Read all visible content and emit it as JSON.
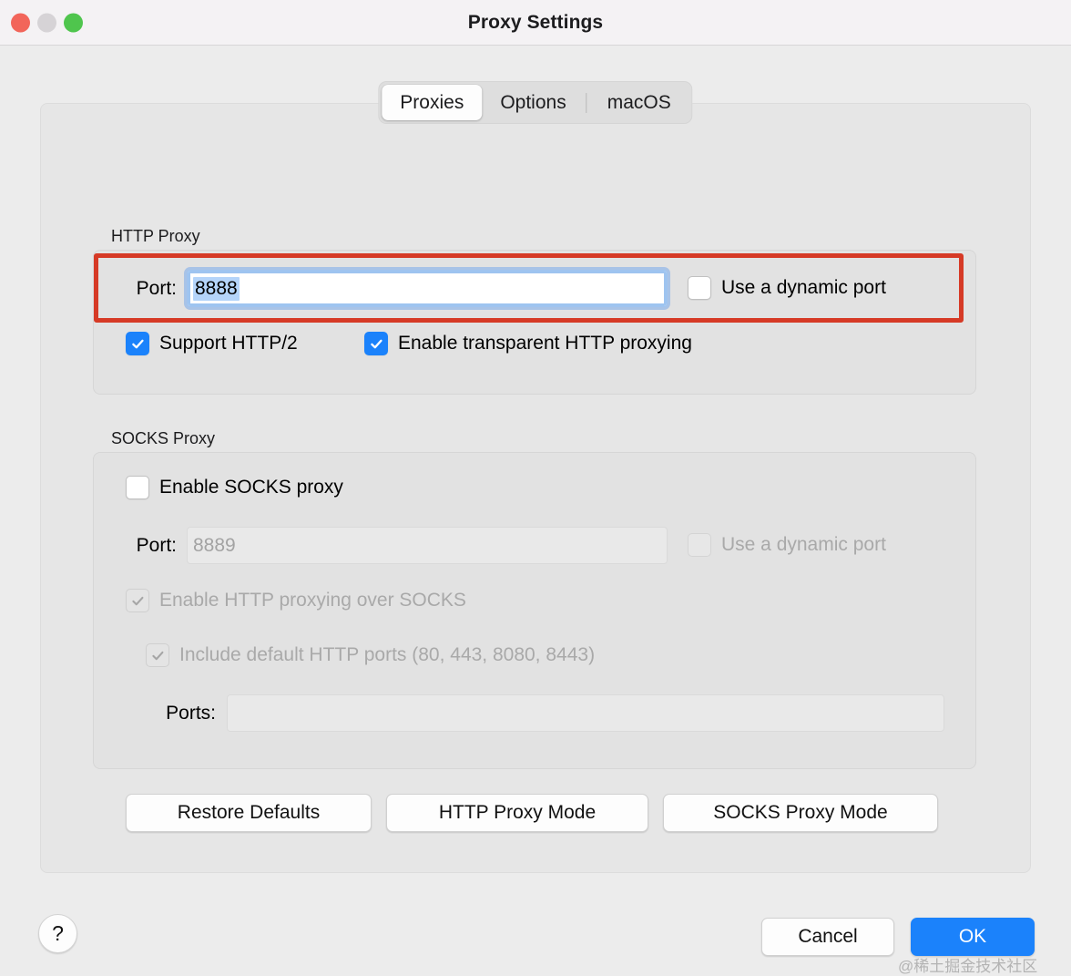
{
  "window": {
    "title": "Proxy Settings",
    "traffic_lights": [
      {
        "name": "close",
        "color": "#f2655a"
      },
      {
        "name": "minimize",
        "color": "#d6d3d6"
      },
      {
        "name": "zoom",
        "color": "#4fc54d"
      }
    ]
  },
  "tabs": [
    {
      "label": "Proxies",
      "selected": true
    },
    {
      "label": "Options",
      "selected": false
    },
    {
      "label": "macOS",
      "selected": false
    }
  ],
  "http_proxy": {
    "group_label": "HTTP Proxy",
    "port_label": "Port:",
    "port_value": "8888",
    "port_selected": true,
    "dynamic_port_label": "Use a dynamic port",
    "dynamic_port_checked": false,
    "support_http2_label": "Support HTTP/2",
    "support_http2_checked": true,
    "transparent_proxy_label": "Enable transparent HTTP proxying",
    "transparent_proxy_checked": true
  },
  "socks_proxy": {
    "group_label": "SOCKS Proxy",
    "enable_label": "Enable SOCKS proxy",
    "enable_checked": false,
    "port_label": "Port:",
    "port_value": "8889",
    "port_disabled": true,
    "dynamic_port_label": "Use a dynamic port",
    "dynamic_port_checked": false,
    "dynamic_port_disabled": true,
    "http_over_socks_label": "Enable HTTP proxying over SOCKS",
    "http_over_socks_checked": true,
    "http_over_socks_disabled": true,
    "default_ports_label": "Include default HTTP ports (80, 443, 8080, 8443)",
    "default_ports_checked": true,
    "default_ports_disabled": true,
    "ports_label": "Ports:",
    "ports_value": ""
  },
  "mode_buttons": {
    "restore_defaults": "Restore Defaults",
    "http_proxy_mode": "HTTP Proxy Mode",
    "socks_proxy_mode": "SOCKS Proxy Mode"
  },
  "footer": {
    "help": "?",
    "cancel": "Cancel",
    "ok": "OK",
    "watermark": "@稀土掘金技术社区"
  },
  "annotation": {
    "color": "#d63a26",
    "target": "http-proxy-port-row"
  },
  "colors": {
    "accent": "#1b82fb",
    "window_bg": "#ececec",
    "panel_bg": "#e6e6e6",
    "group_bg": "#e2e2e2",
    "annotation_red": "#d63a26",
    "selection_blue": "#b4d4fa"
  }
}
